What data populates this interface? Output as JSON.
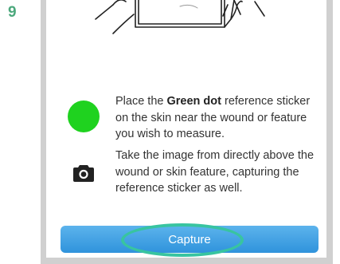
{
  "step": {
    "number": "9"
  },
  "illustration": {
    "icon": "phone-hand-illustration"
  },
  "instructions": [
    {
      "icon": "green-dot-icon",
      "color": "#1fd21f",
      "text_before": "Place the ",
      "text_bold": "Green dot",
      "text_after": " reference sticker on the skin near the wound or feature you wish to measure."
    },
    {
      "icon": "camera-icon",
      "text": "Take the image from directly above the wound or skin feature, capturing the reference sticker as well."
    }
  ],
  "capture_button": {
    "label": "Capture",
    "color": "#2f93dc"
  },
  "highlight": {
    "color": "#38c4a0"
  },
  "accent": {
    "step_color": "#4ba87c"
  }
}
